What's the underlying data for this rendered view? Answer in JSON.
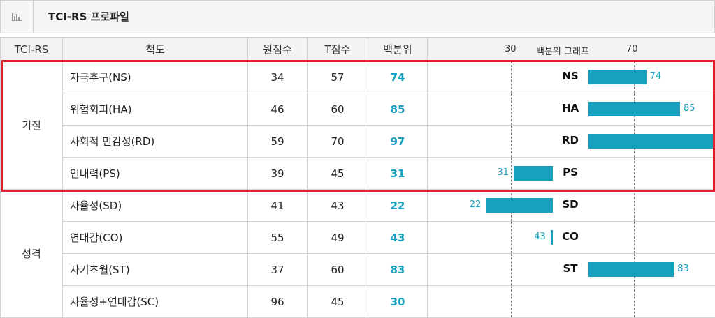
{
  "header": {
    "title": "TCI-RS 프로파일",
    "icon": "bar-chart-icon"
  },
  "columns": {
    "group": "TCI-RS",
    "scale": "척도",
    "raw": "원점수",
    "t": "T점수",
    "pct": "백분위",
    "graph": "백분위 그래프",
    "tick_30": "30",
    "tick_70": "70"
  },
  "groups": {
    "temperament": "기질",
    "character": "성격"
  },
  "rows": [
    {
      "scale": "자극추구(NS)",
      "raw": "34",
      "t": "57",
      "pct": "74",
      "abbr": "NS",
      "value": 74
    },
    {
      "scale": "위험회피(HA)",
      "raw": "46",
      "t": "60",
      "pct": "85",
      "abbr": "HA",
      "value": 85
    },
    {
      "scale": "사회적 민감성(RD)",
      "raw": "59",
      "t": "70",
      "pct": "97",
      "abbr": "RD",
      "value": 97
    },
    {
      "scale": "인내력(PS)",
      "raw": "39",
      "t": "45",
      "pct": "31",
      "abbr": "PS",
      "value": 31
    },
    {
      "scale": "자율성(SD)",
      "raw": "41",
      "t": "43",
      "pct": "22",
      "abbr": "SD",
      "value": 22
    },
    {
      "scale": "연대감(CO)",
      "raw": "55",
      "t": "49",
      "pct": "43",
      "abbr": "CO",
      "value": 43
    },
    {
      "scale": "자기초월(ST)",
      "raw": "37",
      "t": "60",
      "pct": "83",
      "abbr": "ST",
      "value": 83
    },
    {
      "scale": "자율성+연대감(SC)",
      "raw": "96",
      "t": "45",
      "pct": "30",
      "abbr": "",
      "value": null
    }
  ],
  "colors": {
    "bar": "#1aa0bf",
    "highlight": "#e0202a"
  }
}
